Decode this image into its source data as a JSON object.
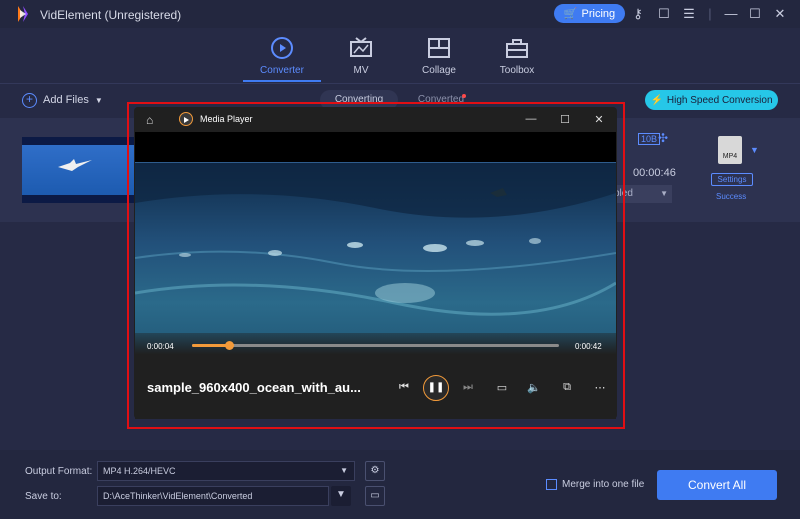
{
  "app": {
    "title": "VidElement (Unregistered)",
    "pricing_label": "Pricing",
    "accent_color": "#3f7bf2"
  },
  "nav": [
    {
      "label": "Converter",
      "icon": "converter-icon",
      "active": true
    },
    {
      "label": "MV",
      "icon": "mv-icon",
      "active": false
    },
    {
      "label": "Collage",
      "icon": "collage-icon",
      "active": false
    },
    {
      "label": "Toolbox",
      "icon": "toolbox-icon",
      "active": false
    }
  ],
  "toolbar": {
    "add_files_label": "Add Files",
    "tab_converting": "Converting",
    "tab_converted": "Converted",
    "high_speed_label": "High Speed Conversion"
  },
  "file_item": {
    "codec_badge": "10B",
    "duration": "00:00:46",
    "subtitle_value": "bled",
    "format_icon": "MP4",
    "settings_label": "Settings",
    "status": "Success"
  },
  "player": {
    "title": "Media Player",
    "current_time": "0:00:04",
    "total_time": "0:00:42",
    "progress": 0.1,
    "file_name": "sample_960x400_ocean_with_au..."
  },
  "bottom": {
    "output_format_label": "Output Format:",
    "output_format_value": "MP4 H.264/HEVC",
    "save_to_label": "Save to:",
    "save_to_value": "D:\\AceThinker\\VidElement\\Converted",
    "merge_label": "Merge into one file",
    "convert_all_label": "Convert All"
  }
}
